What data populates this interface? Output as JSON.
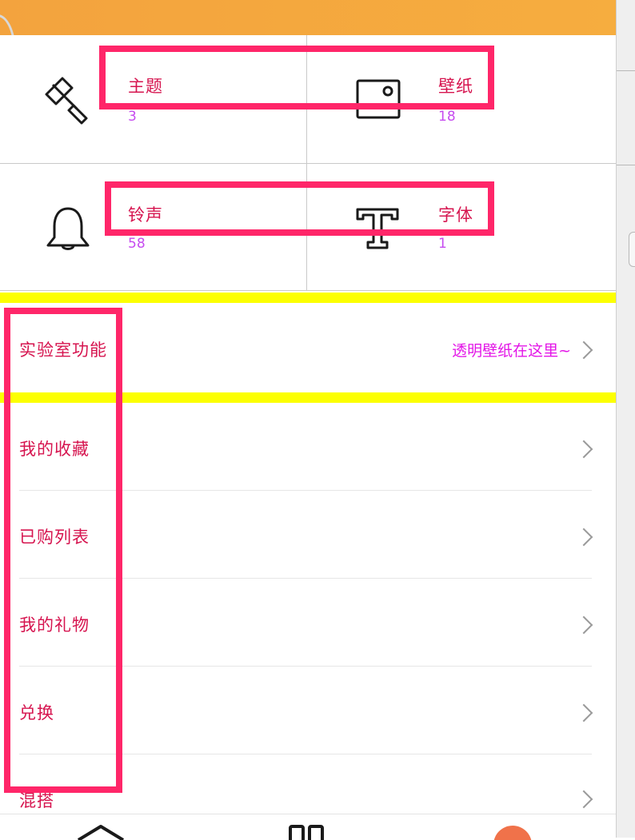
{
  "grid": {
    "items": [
      {
        "label": "主题",
        "count": "3",
        "icon": "paint-brush-icon"
      },
      {
        "label": "壁纸",
        "count": "18",
        "icon": "image-icon"
      },
      {
        "label": "铃声",
        "count": "58",
        "icon": "bell-icon"
      },
      {
        "label": "字体",
        "count": "1",
        "icon": "font-t-icon"
      }
    ]
  },
  "lab": {
    "label": "实验室功能",
    "hint": "透明壁纸在这里~"
  },
  "list": {
    "items": [
      {
        "label": "我的收藏"
      },
      {
        "label": "已购列表"
      },
      {
        "label": "我的礼物"
      },
      {
        "label": "兑换"
      },
      {
        "label": "混搭"
      }
    ]
  },
  "colors": {
    "label": "#d6144f",
    "count": "#c64bf0",
    "annotation": "#ff2669",
    "highlight": "#fcff00",
    "banner": "#f3a33e"
  },
  "bottom_nav": {
    "icons": [
      "home-icon",
      "category-icon",
      "profile-icon"
    ]
  }
}
